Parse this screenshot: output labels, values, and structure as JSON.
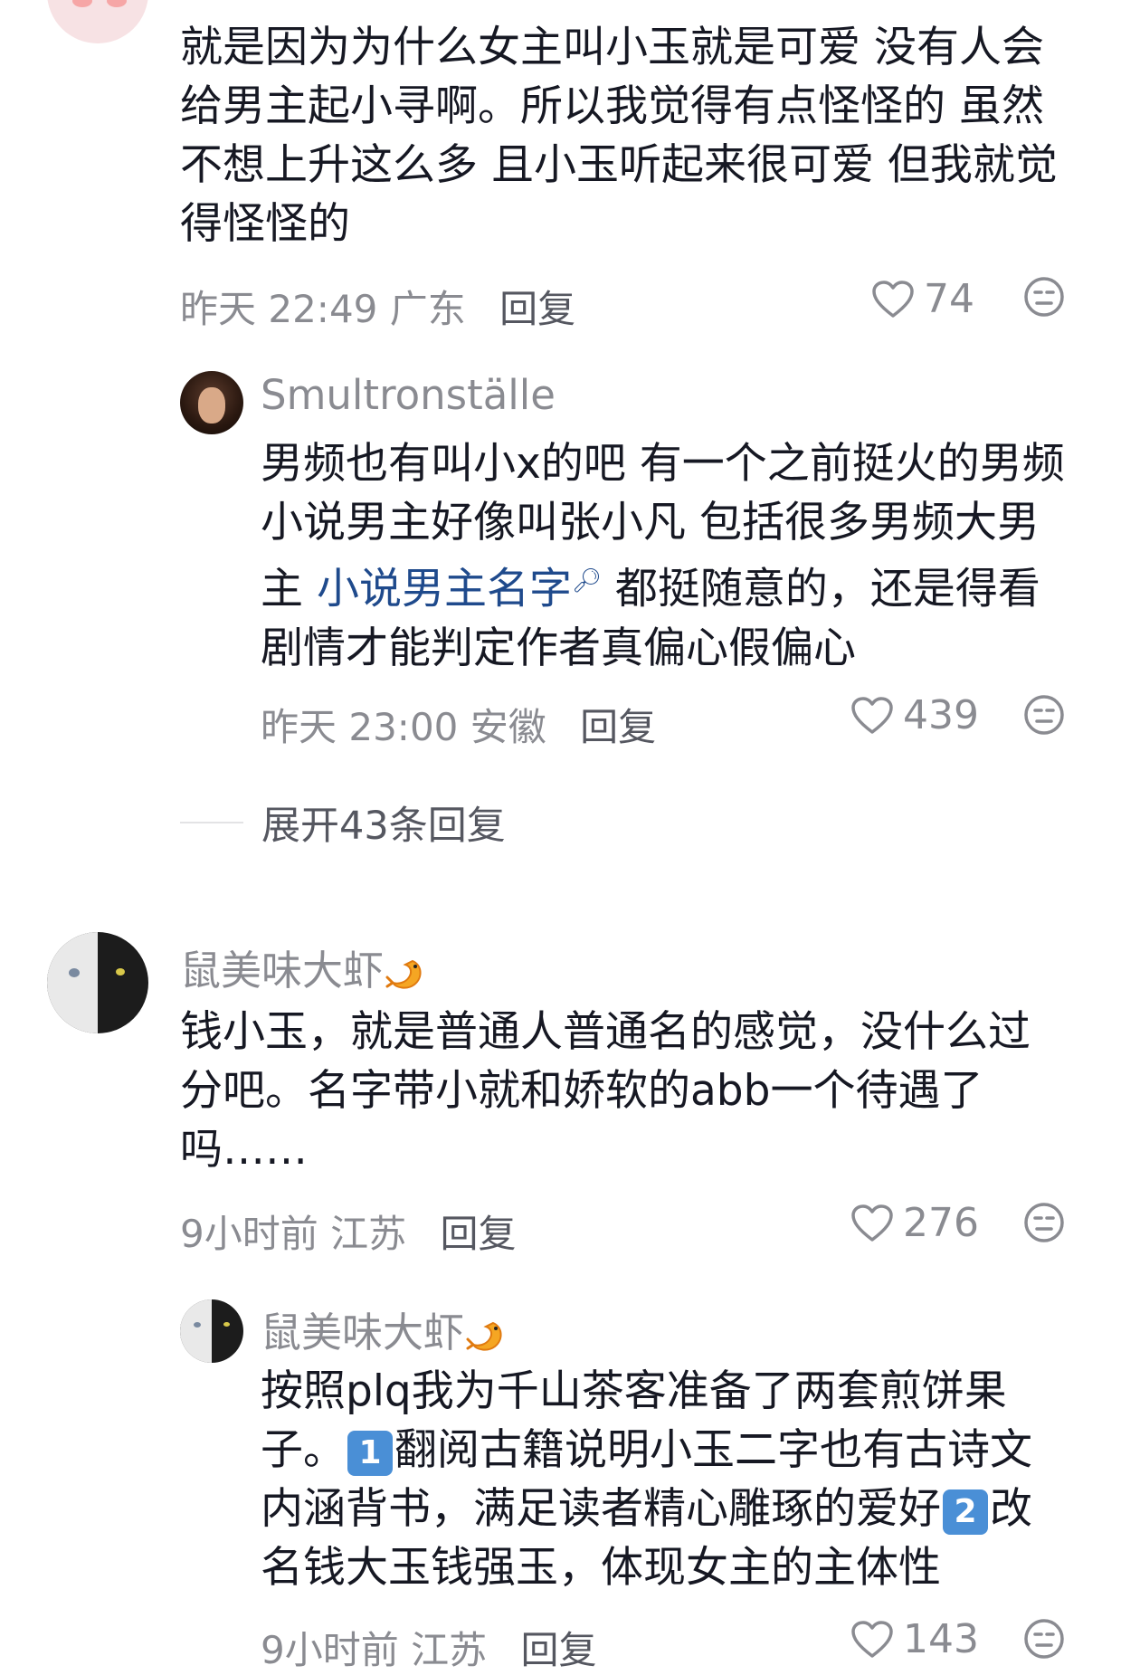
{
  "comments": [
    {
      "id": "c1",
      "text_lines": [
        "就是因为为什么女主叫小玉就是可爱 没有人会",
        "给男主起小寻啊。所以我觉得有点怪怪的 虽然",
        "不想上升这么多 且小玉听起来很可爱 但我就觉",
        "得怪怪的"
      ],
      "time": "昨天 22:49",
      "location": "广东",
      "reply_label": "回复",
      "likes": "74"
    },
    {
      "id": "r1",
      "username": "Smultronställe",
      "text_part1_line1": "男频也有叫小x的吧 有一个之前挺火的男频",
      "text_part1_line2": "小说男主好像叫张小凡 包括很多男频大男",
      "text_part1_line3_prefix": "主 ",
      "text_link": "小说男主名字",
      "text_part1_line3_suffix": " 都挺随意的，还是得看",
      "text_part1_line4": "剧情才能判定作者真偏心假偏心",
      "time": "昨天 23:00",
      "location": "安徽",
      "reply_label": "回复",
      "likes": "439"
    },
    {
      "id": "c2",
      "username": "鼠美味大虾",
      "text_lines": [
        "钱小玉，就是普通人普通名的感觉，没什么过",
        "分吧。名字带小就和娇软的abb一个待遇了",
        "吗……"
      ],
      "time": "9小时前",
      "location": "江苏",
      "reply_label": "回复",
      "likes": "276"
    },
    {
      "id": "r2",
      "username": "鼠美味大虾",
      "line1": "按照plq我为千山茶客准备了两套煎饼果",
      "line2_prefix": "子。",
      "emoji1": "1",
      "line2_suffix": "翻阅古籍说明小玉二字也有古诗文",
      "line3_prefix": "内涵背书，满足读者精心雕琢的爱好",
      "emoji2": "2",
      "line3_suffix": "改",
      "line4": "名钱大玉钱强玉，体现女主的主体性",
      "time": "9小时前",
      "location": "江苏",
      "reply_label": "回复",
      "likes": "143"
    }
  ],
  "expand_replies": "展开43条回复",
  "colors": {
    "text": "#161823",
    "secondary": "#8a8b91",
    "link": "#1f4a8c",
    "background": "#ffffff"
  }
}
